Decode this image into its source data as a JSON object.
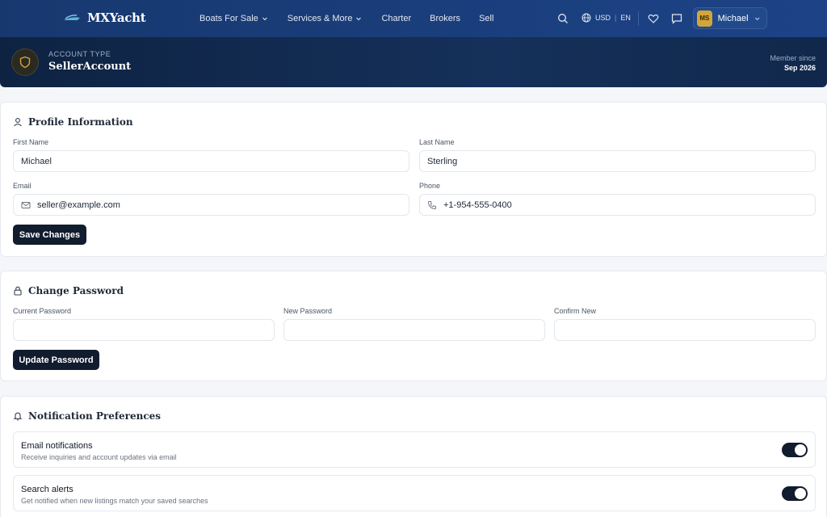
{
  "brand": {
    "name": "MXYacht"
  },
  "nav": {
    "items": [
      {
        "label": "Boats For Sale",
        "has_dropdown": true
      },
      {
        "label": "Services & More",
        "has_dropdown": true
      },
      {
        "label": "Charter",
        "has_dropdown": false
      },
      {
        "label": "Brokers",
        "has_dropdown": false
      },
      {
        "label": "Sell",
        "has_dropdown": false
      }
    ],
    "currency": "USD",
    "language": "EN",
    "user": {
      "initials": "MS",
      "name": "Michael"
    }
  },
  "account": {
    "type_label": "ACCOUNT TYPE",
    "type_value": "SellerAccount",
    "member_since_label": "Member since",
    "member_since_value": "Sep 2026"
  },
  "profile": {
    "title": "Profile Information",
    "first_name_label": "First Name",
    "first_name_value": "Michael",
    "last_name_label": "Last Name",
    "last_name_value": "Sterling",
    "email_label": "Email",
    "email_value": "seller@example.com",
    "phone_label": "Phone",
    "phone_value": "+1-954-555-0400",
    "save_label": "Save Changes"
  },
  "password": {
    "title": "Change Password",
    "current_label": "Current Password",
    "new_label": "New Password",
    "confirm_label": "Confirm New",
    "update_label": "Update Password"
  },
  "notifications": {
    "title": "Notification Preferences",
    "items": [
      {
        "title": "Email notifications",
        "description": "Receive inquiries and account updates via email",
        "enabled": true
      },
      {
        "title": "Search alerts",
        "description": "Get notified when new listings match your saved searches",
        "enabled": true
      }
    ]
  },
  "colors": {
    "header": "#1d4387",
    "banner": "#0e2342",
    "button": "#111c2e",
    "accent_gold": "#d4a53a"
  },
  "icons": [
    "search-icon",
    "globe-icon",
    "heart-icon",
    "message-icon",
    "chevron-down-icon",
    "shield-icon",
    "user-icon",
    "mail-icon",
    "phone-icon",
    "lock-icon",
    "bell-icon"
  ]
}
